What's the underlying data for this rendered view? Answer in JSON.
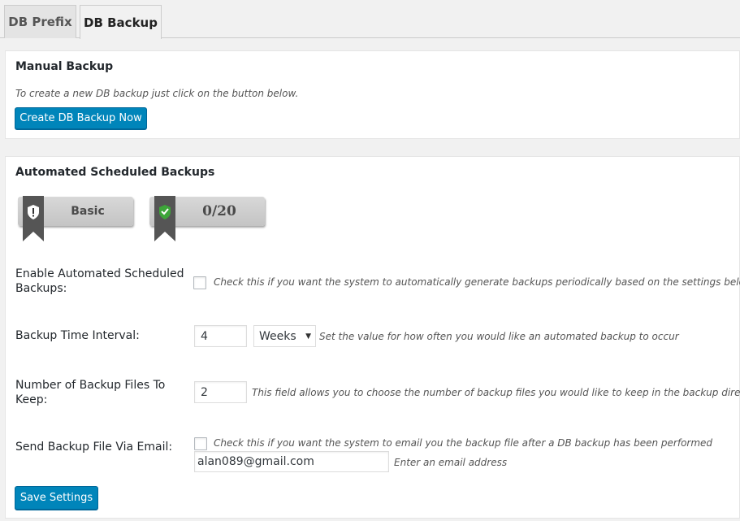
{
  "tabs": [
    {
      "label": "DB Prefix"
    },
    {
      "label": "DB Backup"
    }
  ],
  "manual": {
    "title": "Manual Backup",
    "description": "To create a new DB backup just click on the button below.",
    "button": "Create DB Backup Now"
  },
  "auto": {
    "title": "Automated Scheduled Backups",
    "badges": [
      {
        "text": "Basic",
        "icon": "warning-shield-icon"
      },
      {
        "text": "0/20",
        "icon": "check-shield-icon"
      }
    ],
    "enable": {
      "label": "Enable Automated Scheduled Backups:",
      "description": "Check this if you want the system to automatically generate backups periodically based on the settings below",
      "checked": false
    },
    "interval": {
      "label": "Backup Time Interval:",
      "value": "4",
      "unit": "Weeks",
      "description": "Set the value for how often you would like an automated backup to occur"
    },
    "keep": {
      "label": "Number of Backup Files To Keep:",
      "value": "2",
      "description": "This field allows you to choose the number of backup files you would like to keep in the backup directory"
    },
    "email": {
      "label": "Send Backup File Via Email:",
      "description": "Check this if you want the system to email you the backup file after a DB backup has been performed",
      "checked": false,
      "value": "alan089@gmail.com",
      "hint": "Enter an email address"
    },
    "save": "Save Settings"
  },
  "colors": {
    "primary_button": "#0085ba",
    "background": "#f1f1f1"
  }
}
